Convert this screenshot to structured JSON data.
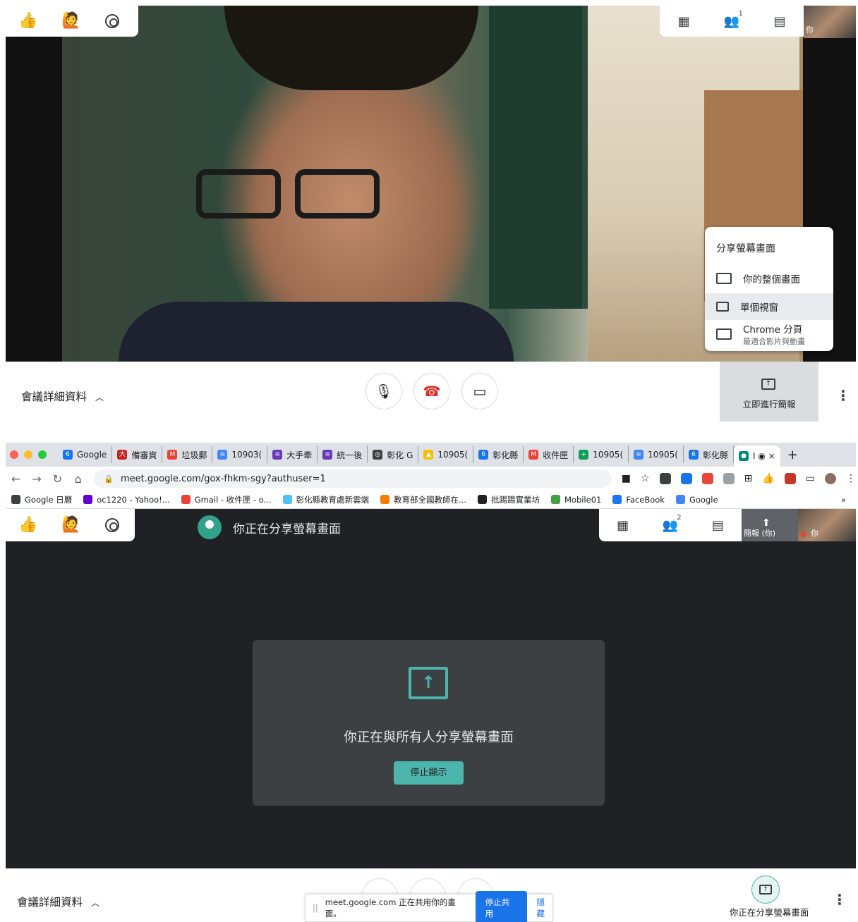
{
  "top_meet": {
    "reactions": [
      "👍",
      "🙋"
    ],
    "participant_count_badge": "1",
    "self_tile_label": "你",
    "share_menu": {
      "title": "分享螢幕畫面",
      "items": [
        {
          "label": "你的整個畫面",
          "sublabel": ""
        },
        {
          "label": "單個視窗",
          "sublabel": ""
        },
        {
          "label": "Chrome 分頁",
          "sublabel": "最適合影片與動畫"
        }
      ]
    },
    "meeting_details": "會議詳細資料",
    "present_now": "立即進行簡報"
  },
  "browser": {
    "tabs": [
      {
        "label": "Google",
        "color": "#1a73e8",
        "icon": "6"
      },
      {
        "label": "備審資",
        "color": "#c5221f",
        "icon": "大"
      },
      {
        "label": "垃圾郵",
        "color": "#ea4335",
        "icon": "M"
      },
      {
        "label": "10903(",
        "color": "#4285f4",
        "icon": "≡"
      },
      {
        "label": "大手牽",
        "color": "#673ab7",
        "icon": "≡"
      },
      {
        "label": "統一後",
        "color": "#673ab7",
        "icon": "≡"
      },
      {
        "label": "彰化 G",
        "color": "#3c4043",
        "icon": "◎"
      },
      {
        "label": "10905(",
        "color": "#fbbc04",
        "icon": "▲"
      },
      {
        "label": "彰化縣",
        "color": "#1a73e8",
        "icon": "6"
      },
      {
        "label": "收件匣",
        "color": "#ea4335",
        "icon": "M"
      },
      {
        "label": "10905(",
        "color": "#0f9d58",
        "icon": "+"
      },
      {
        "label": "10905(",
        "color": "#4285f4",
        "icon": "≡"
      },
      {
        "label": "彰化縣",
        "color": "#1a73e8",
        "icon": "6"
      }
    ],
    "active_tab_label": "I ◉ ×",
    "url": "meet.google.com/gox-fhkm-sgy?authuser=1",
    "bookmarks": [
      {
        "label": "Google 日曆",
        "color": "#3c4043"
      },
      {
        "label": "oc1220 - Yahoo!...",
        "color": "#6001d2"
      },
      {
        "label": "Gmail - 收件匣 - o...",
        "color": "#ea4335"
      },
      {
        "label": "彰化縣教育處新雲端",
        "color": "#4fc3f7"
      },
      {
        "label": "教育部全國教師在...",
        "color": "#f57c00"
      },
      {
        "label": "批踢踢實業坊",
        "color": "#202124"
      },
      {
        "label": "Mobile01",
        "color": "#43a047"
      },
      {
        "label": "FaceBook",
        "color": "#1877f2"
      },
      {
        "label": "Google",
        "color": "#4285f4"
      }
    ],
    "bookmarks_overflow": "»"
  },
  "meet_share": {
    "reactions": [
      "👍",
      "🙋"
    ],
    "banner": "你正在分享螢幕畫面",
    "participant_count_badge": "2",
    "presenting_tile_label": "簡報 (你)",
    "self_tile_label": "你",
    "card_message": "你正在與所有人分享螢幕畫面",
    "stop_label": "停止顯示",
    "meeting_details": "會議詳細資料",
    "present_label": "你正在分享螢幕畫面"
  },
  "chrome_sharing_bar": {
    "message": "meet.google.com 正在共用你的畫面。",
    "stop_button": "停止共用",
    "hide_link": "隱藏"
  },
  "colors": {
    "meet_teal": "#4db6ac",
    "chrome_blue": "#1a73e8",
    "meet_dark": "#202124"
  }
}
